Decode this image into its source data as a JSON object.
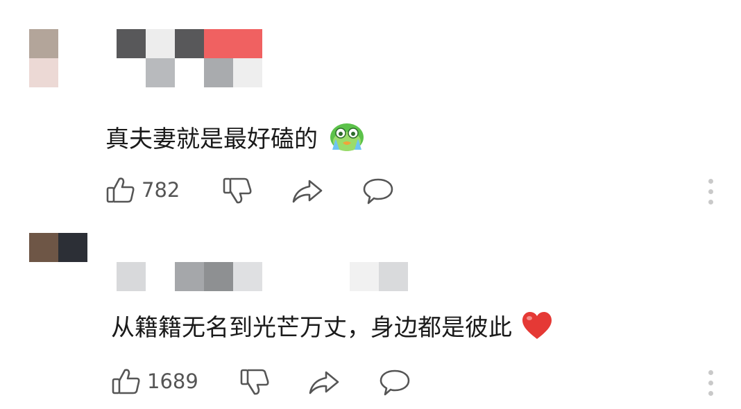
{
  "comments": [
    {
      "text": "真夫妻就是最好磕的",
      "emoji": "crying-face-emoji",
      "likes": "782",
      "avatar_colors": [
        "#b3a59a",
        "#ecd9d5"
      ],
      "username_colors": [
        "#58585a",
        "#ededed",
        "#58585a",
        "#f06161",
        "#b8babd",
        "#a9abae",
        "#eeeeee"
      ]
    },
    {
      "text": "从籍籍无名到光芒万丈，身边都是彼此",
      "emoji": "red-heart-emoji",
      "likes": "1689",
      "avatar_colors": [
        "#6e5646",
        "#2c2f36"
      ],
      "username_colors": [
        "#d8d9db",
        "#a5a7aa",
        "#8e9092",
        "#dfe0e2",
        "#f1f1f1",
        "#d9dadc"
      ]
    }
  ],
  "colors": {
    "icon": "#555555",
    "heart": "#e53935",
    "more": "#c9c9c9"
  }
}
